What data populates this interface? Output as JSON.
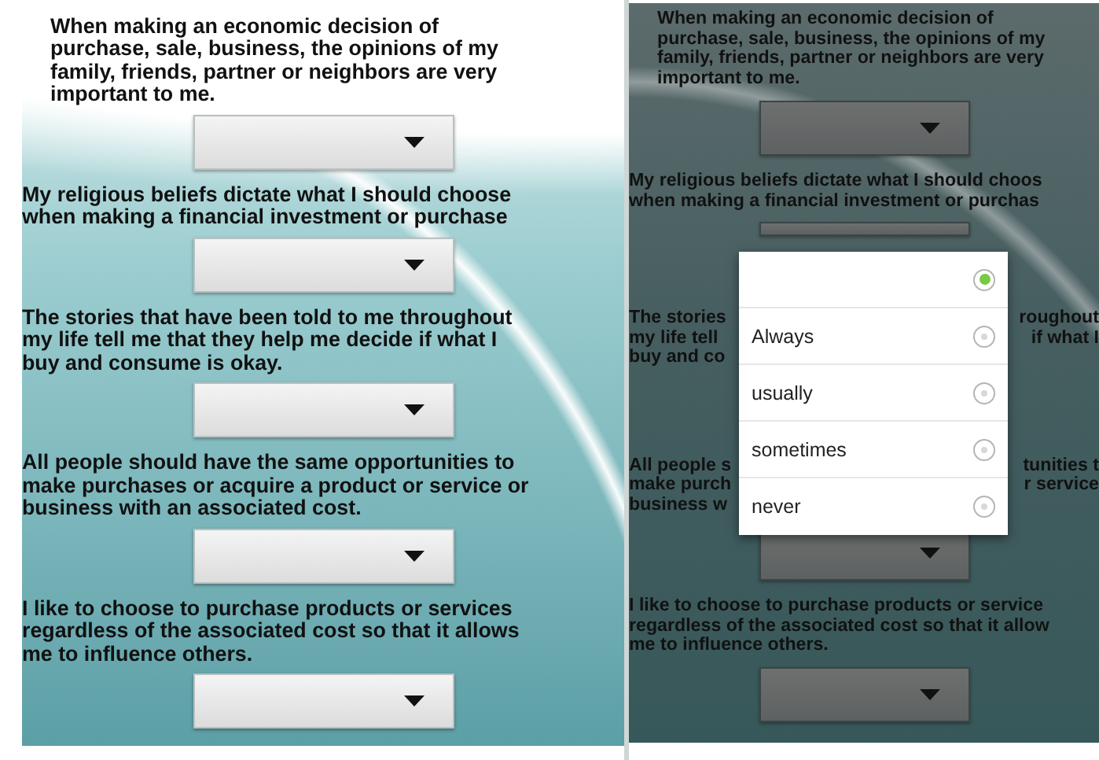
{
  "left_screen": {
    "questions": [
      {
        "indented": true,
        "lines": [
          "When making an economic decision of",
          "purchase, sale, business, the opinions of my",
          "family, friends, partner or neighbors are very",
          "important to me."
        ],
        "dropdown": {
          "covered": false
        }
      },
      {
        "indented": false,
        "lines": [
          "My religious beliefs dictate what I should choose",
          "when making a financial investment or purchase"
        ],
        "dropdown": {
          "covered": false
        }
      },
      {
        "indented": false,
        "lines": [
          "The stories that have been told to me throughout",
          "my life tell me that they help me decide if what I",
          "buy and consume is okay."
        ],
        "dropdown": {
          "covered": false
        }
      },
      {
        "indented": false,
        "lines": [
          "All people should have the same opportunities to",
          "make purchases or acquire a product or service or",
          "business with an associated cost."
        ],
        "dropdown": {
          "covered": false
        }
      },
      {
        "indented": false,
        "lines": [
          "I like to choose to purchase products or services",
          "regardless of the associated cost so that it allows",
          "me to influence others."
        ],
        "dropdown": {
          "covered": false
        }
      }
    ]
  },
  "right_screen": {
    "questions": [
      {
        "indented": true,
        "lines": [
          {
            "left": "When making an economic decision of"
          },
          {
            "left": "purchase, sale, business, the opinions of my"
          },
          {
            "left": "family, friends, partner or neighbors are very"
          },
          {
            "left": "important to me."
          }
        ],
        "dropdown": {
          "covered": false
        }
      },
      {
        "indented": false,
        "lines": [
          {
            "left": "My religious beliefs dictate what I should choos"
          },
          {
            "left": "when making a financial investment or purchas"
          }
        ],
        "dropdown": {
          "covered": true
        }
      },
      {
        "lines": [
          {
            "left": "The stories",
            "right": "roughout"
          },
          {
            "left": "my life tell",
            "right": "if what I"
          },
          {
            "left": "buy and co"
          }
        ]
      },
      {
        "lines": [
          {
            "left": "All people s",
            "right": "tunities t"
          },
          {
            "left": "make purch",
            "right": "r service"
          },
          {
            "left": "business w"
          }
        ],
        "dropdown": {
          "covered": false
        }
      },
      {
        "indented": false,
        "lines": [
          {
            "left": "I like to choose to purchase products or service"
          },
          {
            "left": "regardless of the associated cost so that it allow"
          },
          {
            "left": "me to influence others."
          }
        ],
        "dropdown": {
          "covered": false
        }
      }
    ],
    "popup": {
      "options": [
        {
          "selected": true
        },
        {
          "label": "Always",
          "selected": false
        },
        {
          "label": "usually",
          "selected": false
        },
        {
          "label": "sometimes",
          "selected": false
        },
        {
          "label": "never",
          "selected": false
        }
      ]
    }
  }
}
